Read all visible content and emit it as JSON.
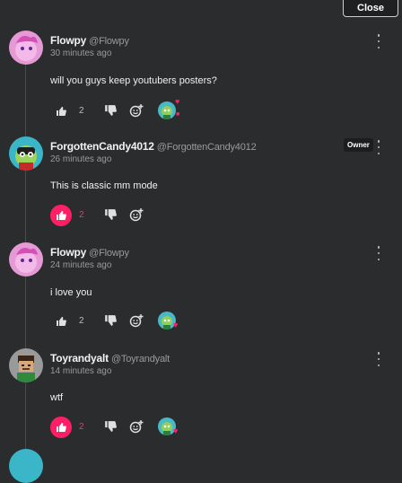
{
  "close_label": "Close",
  "owner_badge": "Owner",
  "comments": [
    {
      "name": "Flowpy",
      "handle": "@Flowpy",
      "time": "30 minutes ago",
      "text": "will you guys keep youtubers posters?",
      "likes": "2",
      "liked": false
    },
    {
      "name": "ForgottenCandy4012",
      "handle": "@ForgottenCandy4012",
      "time": "26 minutes ago",
      "text": "This is classic mm mode",
      "likes": "2",
      "liked": true
    },
    {
      "name": "Flowpy",
      "handle": "@Flowpy",
      "time": "24 minutes ago",
      "text": "i love you",
      "likes": "2",
      "liked": false
    },
    {
      "name": "Toyrandyalt",
      "handle": "@Toyrandyalt",
      "time": "14 minutes ago",
      "text": "wtf",
      "likes": "2",
      "liked": true
    }
  ],
  "colors": {
    "accent": "#ff1f66",
    "background": "#2b2c2d"
  },
  "icons": [
    "thumbs-up-icon",
    "thumbs-down-icon",
    "add-reaction-icon",
    "more-options-icon",
    "heart-icon"
  ]
}
